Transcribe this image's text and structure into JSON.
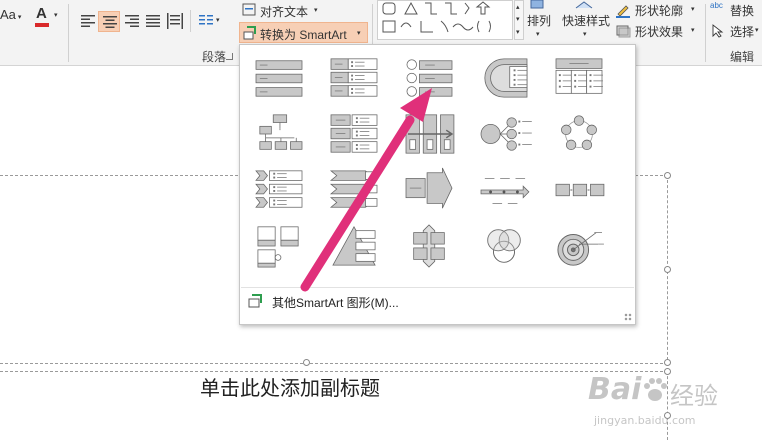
{
  "ribbon": {
    "font_size_label": "Aa",
    "font_color_glyph": "A",
    "align_text_label": "对齐文本",
    "convert_smartart_label": "转换为 SmartArt",
    "paragraph_group_label": "段落",
    "arrange_label": "排列",
    "quick_styles_label": "快速样式",
    "shape_outline_label": "形状轮廓",
    "shape_effects_label": "形状效果",
    "replace_label": "替换",
    "select_label": "选择",
    "editing_group_label": "编辑",
    "font_color_hex": "#d9292a",
    "highlight_hex": "#f7cfb5"
  },
  "gallery": {
    "items": [
      {
        "icon": "vertical-bullet-list"
      },
      {
        "icon": "vertical-box-list"
      },
      {
        "icon": "vertical-circle-list"
      },
      {
        "icon": "target-list"
      },
      {
        "icon": "table-list"
      },
      {
        "icon": "organization-chart"
      },
      {
        "icon": "vertical-block-list"
      },
      {
        "icon": "vertical-arrow-list"
      },
      {
        "icon": "radial-list"
      },
      {
        "icon": "cycle"
      },
      {
        "icon": "chevron-list"
      },
      {
        "icon": "vertical-chevron-list"
      },
      {
        "icon": "process-arrows"
      },
      {
        "icon": "timeline"
      },
      {
        "icon": "basic-process"
      },
      {
        "icon": "picture-caption-list"
      },
      {
        "icon": "pyramid-list"
      },
      {
        "icon": "matrix"
      },
      {
        "icon": "venn"
      },
      {
        "icon": "target"
      }
    ],
    "more_label": "其他SmartArt 图形(M)..."
  },
  "slide": {
    "subtitle_placeholder": "单击此处添加副标题"
  },
  "watermark": {
    "brand": "Bai",
    "brand_suffix": "经验",
    "url": "jingyan.baidu.com"
  },
  "annotation": {
    "arrow_color": "#e0307a"
  }
}
